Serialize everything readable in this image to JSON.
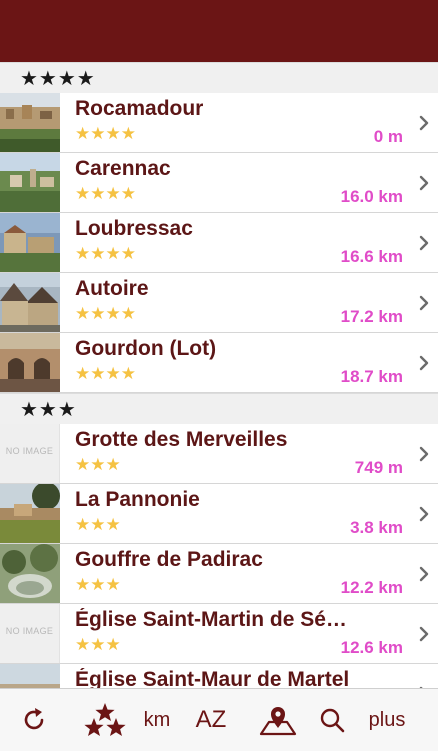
{
  "sections": [
    {
      "header": "★★★★",
      "rows": [
        {
          "title": "Rocamadour",
          "rating": "★★★★",
          "distance": "0 m",
          "image": "photo"
        },
        {
          "title": "Carennac",
          "rating": "★★★★",
          "distance": "16.0 km",
          "image": "photo"
        },
        {
          "title": "Loubressac",
          "rating": "★★★★",
          "distance": "16.6 km",
          "image": "photo"
        },
        {
          "title": "Autoire",
          "rating": "★★★★",
          "distance": "17.2 km",
          "image": "photo"
        },
        {
          "title": "Gourdon (Lot)",
          "rating": "★★★★",
          "distance": "18.7 km",
          "image": "photo"
        }
      ]
    },
    {
      "header": "★★★",
      "rows": [
        {
          "title": "Grotte des Merveilles",
          "rating": "★★★",
          "distance": "749 m",
          "image": "NO IMAGE"
        },
        {
          "title": "La Pannonie",
          "rating": "★★★",
          "distance": "3.8 km",
          "image": "photo"
        },
        {
          "title": "Gouffre de Padirac",
          "rating": "★★★",
          "distance": "12.2 km",
          "image": "photo"
        },
        {
          "title": "Église Saint-Martin de Sé…",
          "rating": "★★★",
          "distance": "12.6 km",
          "image": "NO IMAGE"
        },
        {
          "title": "Église Saint-Maur de Martel",
          "rating": "★★★",
          "distance": "",
          "image": "photo"
        }
      ]
    }
  ],
  "toolbar": {
    "refresh_icon": "refresh-icon",
    "stars_icon": "stars-sort-icon",
    "km_label": "km",
    "az_label": "AZ",
    "map_icon": "map-pin-icon",
    "search_icon": "search-icon",
    "more_label": "plus"
  },
  "colors": {
    "brand": "#6b1515",
    "title": "#5c1616",
    "distance": "#e04cc8",
    "stars": "#f5c242"
  }
}
